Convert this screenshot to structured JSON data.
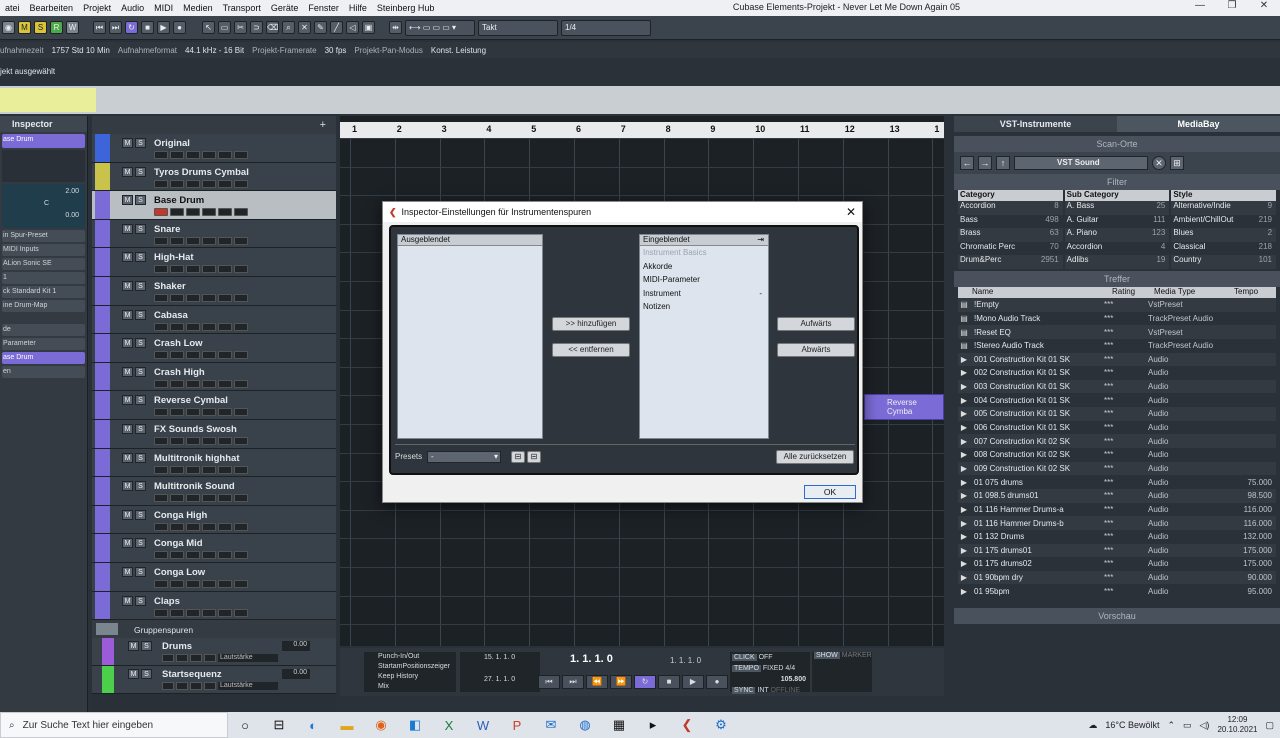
{
  "menubar": {
    "items": [
      "atei",
      "Bearbeiten",
      "Projekt",
      "Audio",
      "MIDI",
      "Medien",
      "Transport",
      "Geräte",
      "Fenster",
      "Hilfe",
      "Steinberg Hub"
    ],
    "window_title": "Cubase Elements-Projekt - Never Let Me Down Again 05"
  },
  "toolbar": {
    "buttons": [
      "M",
      "S",
      "R",
      "W"
    ],
    "snap_label": "Takt",
    "quantize_label": "1/4"
  },
  "status": {
    "rec_time_label": "ufnahmezeit",
    "rec_time_value": "1757 Std 10 Min",
    "rec_format_label": "Aufnahmeformat",
    "rec_format_value": "44.1 kHz - 16 Bit",
    "framerate_label": "Projekt-Framerate",
    "framerate_value": "30 fps",
    "pan_label": "Projekt-Pan-Modus",
    "pan_value": "Konst. Leistung"
  },
  "info_line": "jekt ausgewählt",
  "inspector": {
    "title": "Inspector",
    "track_name": "ase Drum",
    "vol_value": "2.00",
    "pan_value": "0.00",
    "pan_mid": "C",
    "rows": [
      "in Spur-Preset",
      "MIDI Inputs",
      "ALion Sonic SE",
      "1",
      "ck Standard Kit 1",
      "ine Drum-Map",
      "de",
      "Parameter",
      "ase Drum",
      "en"
    ]
  },
  "tracks": [
    {
      "name": "Original",
      "rec": false,
      "color": "b"
    },
    {
      "name": "Tyros Drums Cymbal",
      "rec": false,
      "color": "y"
    },
    {
      "name": "Base Drum",
      "rec": true,
      "color": "p",
      "selected": true
    },
    {
      "name": "Snare",
      "rec": false,
      "color": "p"
    },
    {
      "name": "High-Hat",
      "rec": false,
      "color": "p"
    },
    {
      "name": "Shaker",
      "rec": false,
      "color": "p"
    },
    {
      "name": "Cabasa",
      "rec": false,
      "color": "p"
    },
    {
      "name": "Crash Low",
      "rec": false,
      "color": "p"
    },
    {
      "name": "Crash High",
      "rec": false,
      "color": "p"
    },
    {
      "name": "Reverse Cymbal",
      "rec": false,
      "color": "p"
    },
    {
      "name": "FX Sounds Swosh",
      "rec": false,
      "color": "p"
    },
    {
      "name": "Multitronik highhat",
      "rec": false,
      "color": "p"
    },
    {
      "name": "Multitronik Sound",
      "rec": false,
      "color": "p"
    },
    {
      "name": "Conga High",
      "rec": false,
      "color": "p"
    },
    {
      "name": "Conga Mid",
      "rec": false,
      "color": "p"
    },
    {
      "name": "Conga Low",
      "rec": false,
      "color": "p"
    },
    {
      "name": "Claps",
      "rec": false,
      "color": "p"
    }
  ],
  "group": {
    "label": "Gruppenspuren",
    "tracks": [
      {
        "name": "Drums",
        "value": "0.00",
        "vol_label": "Lautstärke",
        "color": "p"
      },
      {
        "name": "Startsequenz",
        "value": "0.00",
        "vol_label": "Lautstärke",
        "color": "g"
      }
    ]
  },
  "ruler": [
    "1",
    "2",
    "3",
    "4",
    "5",
    "6",
    "7",
    "8",
    "9",
    "10",
    "11",
    "12",
    "13",
    "1"
  ],
  "event_label": "Reverse Cymba",
  "transport": {
    "punch": "Punch-In/Out",
    "start_pos": "StartamPositionszeiger",
    "history": "Keep History",
    "mix": "Mix",
    "left_locator": "15. 1. 1.   0",
    "right_locator": "27. 1. 1.   0",
    "position": "1. 1. 1.   0",
    "position2": "1. 1. 1.   0",
    "click": "CLICK",
    "click_state": "OFF",
    "tempo": "TEMPO",
    "tempo_mode": "FIXED",
    "signature": "4/4",
    "tempo_value": "105.800",
    "sync": "SYNC",
    "sync_mode": "INT",
    "offline": "OFFLINE",
    "show": "SHOW",
    "marker": "MARKER"
  },
  "right_panel": {
    "tab1": "VST-Instrumente",
    "tab2": "MediaBay",
    "scan": "Scan-Orte",
    "vst_location": "VST Sound",
    "filter": "Filter",
    "treffer": "Treffer",
    "vorschau": "Vorschau",
    "category": {
      "header": "Category",
      "rows": [
        [
          "Accordion",
          "8"
        ],
        [
          "Bass",
          "498"
        ],
        [
          "Brass",
          "63"
        ],
        [
          "Chromatic Perc",
          "70"
        ],
        [
          "Drum&Perc",
          "2951"
        ]
      ]
    },
    "subcategory": {
      "header": "Sub Category",
      "rows": [
        [
          "A. Bass",
          "25"
        ],
        [
          "A. Guitar",
          "111"
        ],
        [
          "A. Piano",
          "123"
        ],
        [
          "Accordion",
          "4"
        ],
        [
          "Adlibs",
          "19"
        ]
      ]
    },
    "style": {
      "header": "Style",
      "rows": [
        [
          "Alternative/Indie",
          "9"
        ],
        [
          "Ambient/ChillOut",
          "219"
        ],
        [
          "Blues",
          "2"
        ],
        [
          "Classical",
          "218"
        ],
        [
          "Country",
          "101"
        ]
      ]
    },
    "columns": [
      "Name",
      "Rating",
      "Media Type",
      "Tempo"
    ],
    "results": [
      {
        "name": "!Empty",
        "rating": "***",
        "type": "VstPreset",
        "tempo": ""
      },
      {
        "name": "!Mono Audio Track",
        "rating": "***",
        "type": "TrackPreset Audio",
        "tempo": ""
      },
      {
        "name": "!Reset EQ",
        "rating": "***",
        "type": "VstPreset",
        "tempo": ""
      },
      {
        "name": "!Stereo Audio Track",
        "rating": "***",
        "type": "TrackPreset Audio",
        "tempo": ""
      },
      {
        "name": "001 Construction Kit 01 SK",
        "rating": "***",
        "type": "Audio",
        "tempo": ""
      },
      {
        "name": "002 Construction Kit 01 SK",
        "rating": "***",
        "type": "Audio",
        "tempo": ""
      },
      {
        "name": "003 Construction Kit 01 SK",
        "rating": "***",
        "type": "Audio",
        "tempo": ""
      },
      {
        "name": "004 Construction Kit 01 SK",
        "rating": "***",
        "type": "Audio",
        "tempo": ""
      },
      {
        "name": "005 Construction Kit 01 SK",
        "rating": "***",
        "type": "Audio",
        "tempo": ""
      },
      {
        "name": "006 Construction Kit 01 SK",
        "rating": "***",
        "type": "Audio",
        "tempo": ""
      },
      {
        "name": "007 Construction Kit 02 SK",
        "rating": "***",
        "type": "Audio",
        "tempo": ""
      },
      {
        "name": "008 Construction Kit 02 SK",
        "rating": "***",
        "type": "Audio",
        "tempo": ""
      },
      {
        "name": "009 Construction Kit 02 SK",
        "rating": "***",
        "type": "Audio",
        "tempo": ""
      },
      {
        "name": "01 075 drums",
        "rating": "***",
        "type": "Audio",
        "tempo": "75.000"
      },
      {
        "name": "01 098.5 drums01",
        "rating": "***",
        "type": "Audio",
        "tempo": "98.500"
      },
      {
        "name": "01 116 Hammer Drums-a",
        "rating": "***",
        "type": "Audio",
        "tempo": "116.000"
      },
      {
        "name": "01 116 Hammer Drums-b",
        "rating": "***",
        "type": "Audio",
        "tempo": "116.000"
      },
      {
        "name": "01 132 Drums",
        "rating": "***",
        "type": "Audio",
        "tempo": "132.000"
      },
      {
        "name": "01 175 drums01",
        "rating": "***",
        "type": "Audio",
        "tempo": "175.000"
      },
      {
        "name": "01 175 drums02",
        "rating": "***",
        "type": "Audio",
        "tempo": "175.000"
      },
      {
        "name": "01 90bpm dry",
        "rating": "***",
        "type": "Audio",
        "tempo": "90.000"
      },
      {
        "name": "01 95bpm",
        "rating": "***",
        "type": "Audio",
        "tempo": "95.000"
      }
    ]
  },
  "dialog": {
    "title": "Inspector-Einstellungen für Instrumentenspuren",
    "hidden_header": "Ausgeblendet",
    "shown_header": "Eingeblendet",
    "shown_items": [
      {
        "label": "Instrument Basics",
        "disabled": true,
        "mark": ""
      },
      {
        "label": "Akkorde",
        "disabled": false,
        "mark": ""
      },
      {
        "label": "MIDI-Parameter",
        "disabled": false,
        "mark": ""
      },
      {
        "label": "Instrument",
        "disabled": false,
        "mark": "-"
      },
      {
        "label": "Notizen",
        "disabled": false,
        "mark": ""
      }
    ],
    "add_label": ">> hinzufügen",
    "remove_label": "<< entfernen",
    "up_label": "Aufwärts",
    "down_label": "Abwärts",
    "presets_label": "Presets",
    "presets_value": "-",
    "reset_label": "Alle zurücksetzen",
    "ok_label": "OK"
  },
  "taskbar": {
    "search_placeholder": "Zur Suche Text hier eingeben",
    "weather": "16°C  Bewölkt",
    "time": "12:09",
    "date": "20.10.2021"
  },
  "colors": {
    "accent": "#7b6bd6",
    "record": "#c0392b",
    "panel": "#2b3138"
  }
}
